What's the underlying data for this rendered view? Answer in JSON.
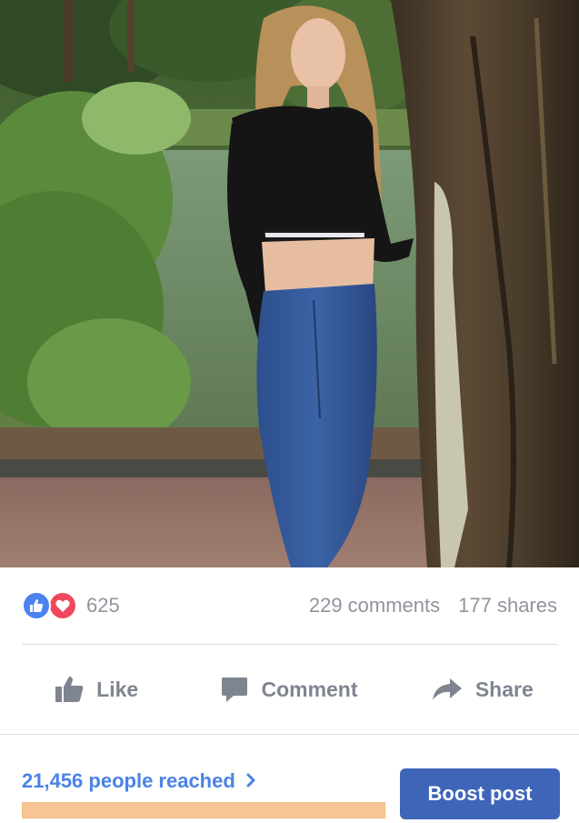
{
  "post": {
    "photo_description_icon": "photo-image"
  },
  "stats": {
    "reaction_count": "625",
    "comments": "229 comments",
    "shares": "177 shares",
    "reaction_icons": [
      "like-icon",
      "love-icon"
    ]
  },
  "actions": {
    "like_label": "Like",
    "comment_label": "Comment",
    "share_label": "Share"
  },
  "footer": {
    "reach_label": "21,456 people reached",
    "reach_progress": 1.0,
    "boost_label": "Boost post"
  },
  "colors": {
    "like_blue": "#4b82f0",
    "love_red": "#f0475c",
    "link_blue": "#4b82e6",
    "boost_blue": "#3e65b8",
    "progress_orange": "#f7c494",
    "muted_gray": "#90949c"
  }
}
